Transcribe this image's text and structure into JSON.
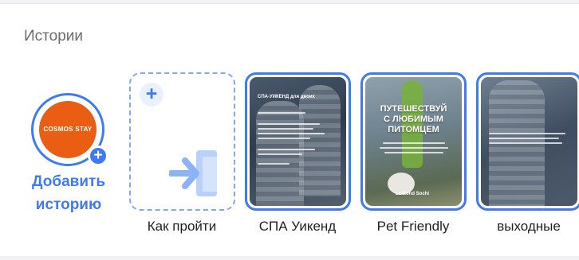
{
  "section": {
    "title": "Истории"
  },
  "add_story": {
    "avatar_brand": "COSMOS STAY",
    "label_line1": "Добавить",
    "label_line2": "историю"
  },
  "how_to_get": {
    "label": "Как пройти"
  },
  "stories": [
    {
      "label": "СПА Уикенд",
      "overlay_title": "СПА-УИКЕНД для двоих"
    },
    {
      "label": "Pet Friendly",
      "overlay_title_line1": "ПУТЕШЕСТВУЙ",
      "overlay_title_line2": "С ЛЮБИМЫМ",
      "overlay_title_line3": "ПИТОМЦЕМ",
      "overlay_brand": "Le Rond Sochi"
    },
    {
      "label": "выходные"
    }
  ],
  "colors": {
    "accent": "#3e7bf0",
    "avatar_bg": "#ea5e14",
    "text": "#1f1f24",
    "muted": "#6b6b72"
  }
}
